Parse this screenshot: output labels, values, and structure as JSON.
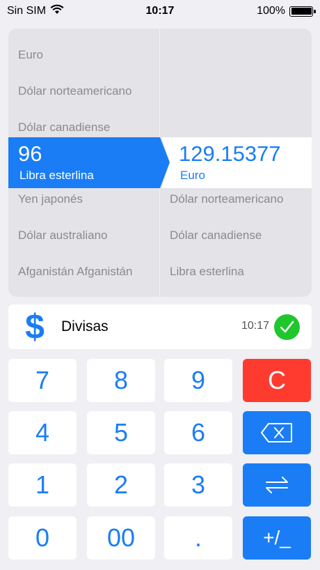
{
  "status_bar": {
    "carrier": "Sin SIM",
    "time": "10:17",
    "battery": "100%"
  },
  "picker": {
    "left_above": [
      "Euro",
      "Dólar norteamericano",
      "Dólar canadiense"
    ],
    "left_selected": {
      "amount": "96",
      "name": "Libra esterlina"
    },
    "left_below": [
      "Yen japonés",
      "Dólar australiano",
      "Afganistán Afganistán"
    ],
    "right_selected": {
      "amount": "129.15377",
      "name": "Euro"
    },
    "right_below": [
      "Dólar norteamericano",
      "Dólar canadiense",
      "Libra esterlina"
    ]
  },
  "category": {
    "icon": "dollar-icon",
    "label": "Divisas",
    "time": "10:17",
    "status_icon": "check-icon"
  },
  "keypad": {
    "k7": "7",
    "k8": "8",
    "k9": "9",
    "clear": "C",
    "k4": "4",
    "k5": "5",
    "k6": "6",
    "k1": "1",
    "k2": "2",
    "k3": "3",
    "k0": "0",
    "k00": "00",
    "dot": ".",
    "sign": "+/_"
  },
  "colors": {
    "accent": "#1a7df5",
    "clear": "#ff3b30",
    "success": "#1fc72d",
    "background": "#efeff4"
  }
}
